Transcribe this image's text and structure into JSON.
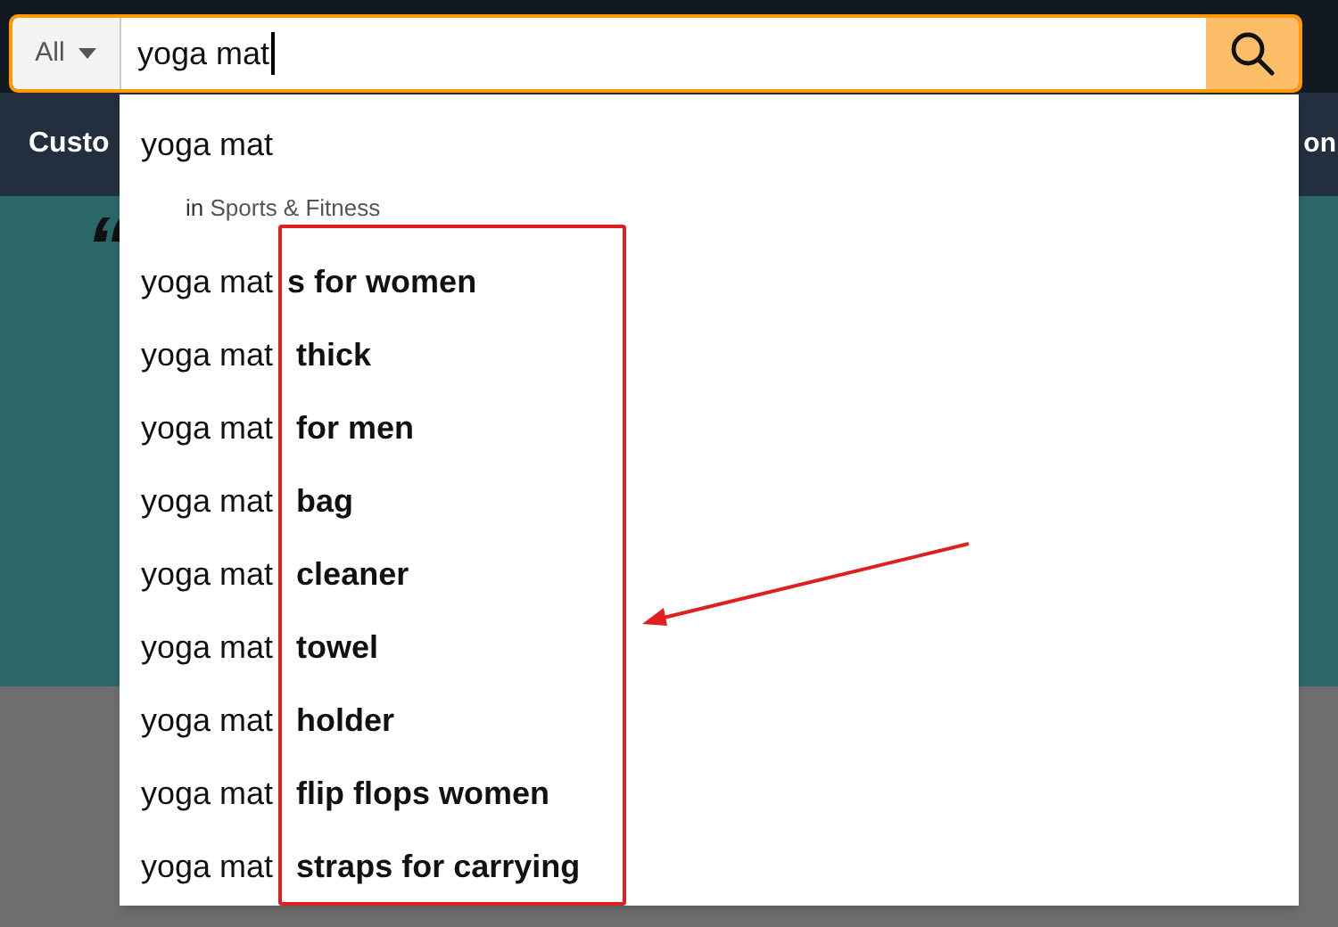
{
  "search": {
    "category": "All",
    "value": "yoga mat"
  },
  "nav": {
    "left": "Custo",
    "right": "on"
  },
  "banner": {
    "quote": "“"
  },
  "suggestions": [
    {
      "kind": "plain",
      "text": "yoga mat"
    },
    {
      "kind": "department",
      "prefix": "in",
      "text": "Sports & Fitness"
    },
    {
      "kind": "plain",
      "text": "yoga mat**s for women**"
    },
    {
      "kind": "plain",
      "text": "yoga mat **thick**"
    },
    {
      "kind": "plain",
      "text": "yoga mat **for men**"
    },
    {
      "kind": "plain",
      "text": "yoga mat **bag**"
    },
    {
      "kind": "plain",
      "text": "yoga mat **cleaner**"
    },
    {
      "kind": "plain",
      "text": "yoga mat **towel**"
    },
    {
      "kind": "plain",
      "text": "yoga mat **holder**"
    },
    {
      "kind": "plain",
      "text": "yoga mat **flip flops women**"
    },
    {
      "kind": "plain",
      "text": "yoga mat **straps for carrying**"
    }
  ]
}
